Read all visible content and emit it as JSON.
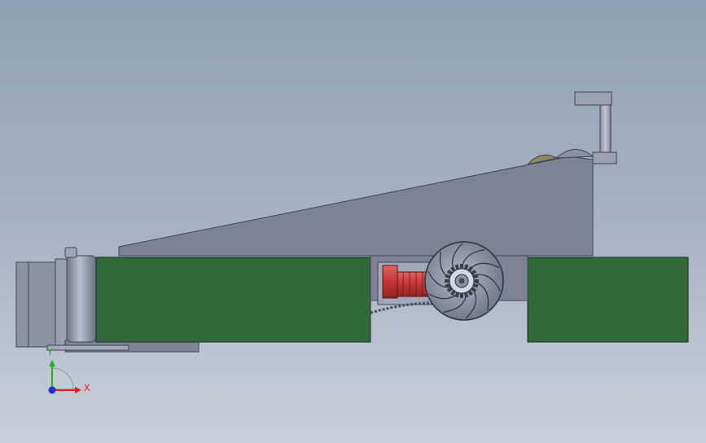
{
  "viewport": {
    "colors": {
      "background_top": "#8fa0b6",
      "background_bottom": "#c8d0da",
      "frame": "#7d8394",
      "green_panel": "#316a3a",
      "motor": "#c53434"
    }
  },
  "triad": {
    "x_label": "X",
    "y_label": "Y",
    "x_color": "#e02020",
    "y_color": "#20b020",
    "z_color": "#2030d0"
  }
}
